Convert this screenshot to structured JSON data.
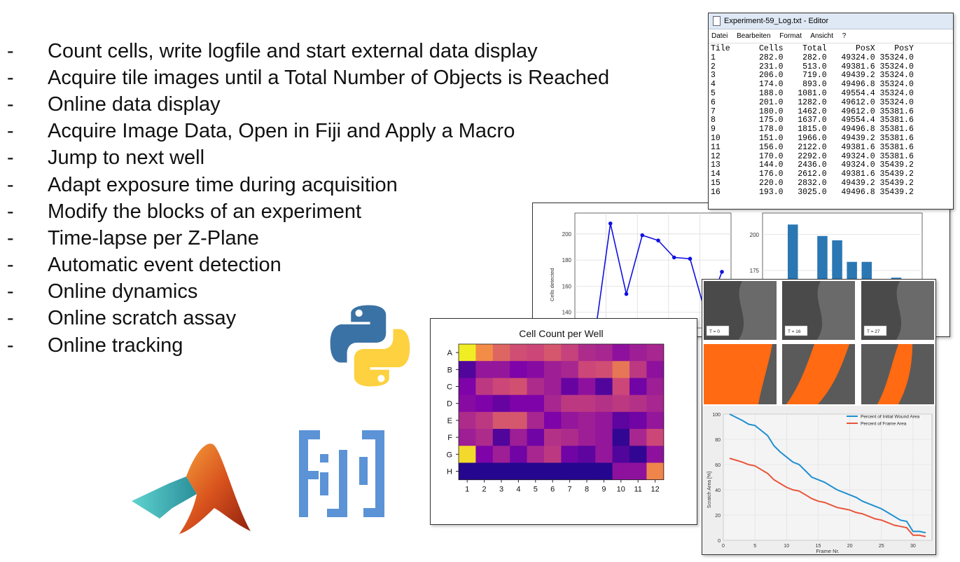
{
  "bullets": [
    {
      "dash": "-",
      "text": "Count cells, write logfile and start external data display"
    },
    {
      "dash": "-",
      "text": "Acquire tile images until a Total Number of Objects is Reached"
    },
    {
      "dash": "-",
      "text": "Online data display"
    },
    {
      "dash": "-",
      "text": "Acquire Image Data, Open in Fiji and Apply a Macro"
    },
    {
      "dash": "-",
      "text": "Jump to next well"
    },
    {
      "dash": "-",
      "text": "Adapt exposure time during acquisition"
    },
    {
      "dash": "-",
      "text": "Modify the blocks of an experiment"
    },
    {
      "dash": "-",
      "text": "Time-lapse per Z-Plane"
    },
    {
      "dash": "-",
      "text": "Automatic event detection"
    },
    {
      "dash": "-",
      "text": "Online dynamics"
    },
    {
      "dash": "-",
      "text": "Online scratch assay"
    },
    {
      "dash": "-",
      "text": "Online tracking"
    }
  ],
  "editor": {
    "title": "Experiment-59_Log.txt - Editor",
    "menu": [
      "Datei",
      "Bearbeiten",
      "Format",
      "Ansicht",
      "?"
    ],
    "columns": [
      "Tile",
      "Cells",
      "Total",
      "PosX",
      "PosY"
    ],
    "rows": [
      [
        "1",
        "282.0",
        "282.0",
        "49324.0",
        "35324.0"
      ],
      [
        "2",
        "231.0",
        "513.0",
        "49381.6",
        "35324.0"
      ],
      [
        "3",
        "206.0",
        "719.0",
        "49439.2",
        "35324.0"
      ],
      [
        "4",
        "174.0",
        "893.0",
        "49496.8",
        "35324.0"
      ],
      [
        "5",
        "188.0",
        "1081.0",
        "49554.4",
        "35324.0"
      ],
      [
        "6",
        "201.0",
        "1282.0",
        "49612.0",
        "35324.0"
      ],
      [
        "7",
        "180.0",
        "1462.0",
        "49612.0",
        "35381.6"
      ],
      [
        "8",
        "175.0",
        "1637.0",
        "49554.4",
        "35381.6"
      ],
      [
        "9",
        "178.0",
        "1815.0",
        "49496.8",
        "35381.6"
      ],
      [
        "10",
        "151.0",
        "1966.0",
        "49439.2",
        "35381.6"
      ],
      [
        "11",
        "156.0",
        "2122.0",
        "49381.6",
        "35381.6"
      ],
      [
        "12",
        "170.0",
        "2292.0",
        "49324.0",
        "35381.6"
      ],
      [
        "13",
        "144.0",
        "2436.0",
        "49324.0",
        "35439.2"
      ],
      [
        "14",
        "176.0",
        "2612.0",
        "49381.6",
        "35439.2"
      ],
      [
        "15",
        "220.0",
        "2832.0",
        "49439.2",
        "35439.2"
      ],
      [
        "16",
        "193.0",
        "3025.0",
        "49496.8",
        "35439.2"
      ]
    ]
  },
  "time_plot": {
    "ylabel": "Cells detected",
    "yticks": [
      "200",
      "180",
      "160",
      "140"
    ],
    "ylim": [
      128,
      216
    ],
    "values": [
      120,
      208,
      154,
      199,
      195,
      182,
      181,
      138,
      171
    ]
  },
  "bar_plot": {
    "yticks": [
      "200",
      "175",
      "150"
    ],
    "ylim": [
      135,
      215
    ],
    "values": [
      207,
      153,
      199,
      196,
      181,
      181,
      139,
      170,
      144
    ]
  },
  "heatmap": {
    "title": "Cell Count per Well",
    "rows": [
      "A",
      "B",
      "C",
      "D",
      "E",
      "F",
      "G",
      "H"
    ],
    "cols": [
      "1",
      "2",
      "3",
      "4",
      "5",
      "6",
      "7",
      "8",
      "9",
      "10",
      "11",
      "12"
    ],
    "values": [
      [
        0.97,
        0.72,
        0.6,
        0.52,
        0.5,
        0.55,
        0.48,
        0.4,
        0.38,
        0.3,
        0.35,
        0.38
      ],
      [
        0.15,
        0.32,
        0.32,
        0.25,
        0.28,
        0.35,
        0.38,
        0.5,
        0.52,
        0.65,
        0.45,
        0.3
      ],
      [
        0.25,
        0.45,
        0.5,
        0.53,
        0.4,
        0.35,
        0.2,
        0.3,
        0.15,
        0.5,
        0.22,
        0.35
      ],
      [
        0.28,
        0.25,
        0.2,
        0.25,
        0.25,
        0.38,
        0.45,
        0.45,
        0.42,
        0.45,
        0.42,
        0.38
      ],
      [
        0.4,
        0.45,
        0.55,
        0.55,
        0.38,
        0.25,
        0.32,
        0.35,
        0.32,
        0.18,
        0.22,
        0.32
      ],
      [
        0.35,
        0.4,
        0.15,
        0.35,
        0.22,
        0.42,
        0.4,
        0.35,
        0.32,
        0.08,
        0.38,
        0.5
      ],
      [
        0.92,
        0.25,
        0.35,
        0.22,
        0.38,
        0.45,
        0.22,
        0.18,
        0.32,
        0.15,
        0.08,
        0.3
      ],
      [
        0.05,
        0.05,
        0.05,
        0.05,
        0.05,
        0.05,
        0.05,
        0.05,
        0.05,
        0.3,
        0.3,
        0.7
      ]
    ]
  },
  "scratch": {
    "frame_labels": [
      "T = 0",
      "T = 16",
      "T = 27"
    ],
    "chart_data": {
      "type": "line",
      "xlabel": "Frame Nr.",
      "ylabel": "Scratch Area [%]",
      "xlim": [
        0,
        33
      ],
      "ylim": [
        0,
        100
      ],
      "xticks": [
        "0",
        "5",
        "10",
        "15",
        "20",
        "25",
        "30"
      ],
      "yticks": [
        "0",
        "20",
        "40",
        "60",
        "80",
        "100"
      ],
      "legend_position": "top-right",
      "series": [
        {
          "name": "Percent of Initial Wound Area",
          "color": "#1f8fd0",
          "x": [
            1,
            3,
            4,
            5,
            6,
            7,
            8,
            9,
            10,
            11,
            12,
            13,
            14,
            15,
            16,
            17,
            18,
            19,
            20,
            21,
            22,
            23,
            24,
            25,
            26,
            27,
            28,
            29,
            30,
            31,
            32
          ],
          "y": [
            100,
            95,
            92,
            91,
            87,
            83,
            75,
            70,
            66,
            62,
            60,
            55,
            50,
            48,
            46,
            43,
            40,
            38,
            36,
            34,
            31,
            29,
            27,
            25,
            22,
            19,
            16,
            15,
            7,
            7,
            6
          ]
        },
        {
          "name": "Percent of Frame Area",
          "color": "#e8553a",
          "x": [
            1,
            3,
            4,
            5,
            6,
            7,
            8,
            9,
            10,
            11,
            12,
            13,
            14,
            15,
            16,
            17,
            18,
            19,
            20,
            21,
            22,
            23,
            24,
            25,
            26,
            27,
            28,
            29,
            30,
            31,
            32
          ],
          "y": [
            65,
            62,
            60,
            59,
            56,
            53,
            48,
            45,
            42,
            40,
            39,
            36,
            33,
            31,
            30,
            28,
            26,
            25,
            24,
            22,
            21,
            19,
            17,
            16,
            14,
            12,
            11,
            10,
            4,
            4,
            3
          ]
        }
      ]
    }
  },
  "logos": [
    "python-logo-icon",
    "fiji-logo-icon",
    "matlab-logo-icon"
  ]
}
